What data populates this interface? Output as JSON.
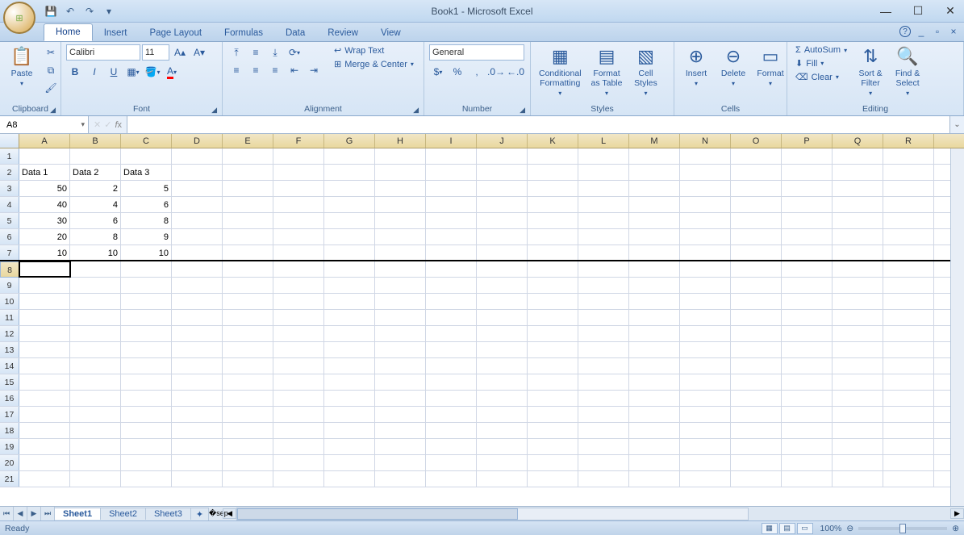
{
  "title": "Book1 - Microsoft Excel",
  "qat": {
    "save": "💾",
    "undo": "↶",
    "redo": "↷"
  },
  "tabs": [
    "Home",
    "Insert",
    "Page Layout",
    "Formulas",
    "Data",
    "Review",
    "View"
  ],
  "active_tab": "Home",
  "ribbon": {
    "clipboard": {
      "label": "Clipboard",
      "paste": "Paste"
    },
    "font": {
      "label": "Font",
      "name": "Calibri",
      "size": "11"
    },
    "alignment": {
      "label": "Alignment",
      "wrap": "Wrap Text",
      "merge": "Merge & Center"
    },
    "number": {
      "label": "Number",
      "format": "General"
    },
    "styles": {
      "label": "Styles",
      "cond": "Conditional\nFormatting",
      "fmt": "Format\nas Table",
      "cell": "Cell\nStyles"
    },
    "cells": {
      "label": "Cells",
      "ins": "Insert",
      "del": "Delete",
      "fmt": "Format"
    },
    "editing": {
      "label": "Editing",
      "autosum": "AutoSum",
      "fill": "Fill",
      "clear": "Clear",
      "sort": "Sort &\nFilter",
      "find": "Find &\nSelect"
    }
  },
  "namebox": "A8",
  "formula": "",
  "columns": [
    "A",
    "B",
    "C",
    "D",
    "E",
    "F",
    "G",
    "H",
    "I",
    "J",
    "K",
    "L",
    "M",
    "N",
    "O",
    "P",
    "Q",
    "R"
  ],
  "row_count": 21,
  "active_cell": {
    "row": 8,
    "col": 0
  },
  "data": {
    "2": {
      "A": "Data 1",
      "B": "Data 2",
      "C": "Data 3"
    },
    "3": {
      "A": "50",
      "B": "2",
      "C": "5"
    },
    "4": {
      "A": "40",
      "B": "4",
      "C": "6"
    },
    "5": {
      "A": "30",
      "B": "6",
      "C": "8"
    },
    "6": {
      "A": "20",
      "B": "8",
      "C": "9"
    },
    "7": {
      "A": "10",
      "B": "10",
      "C": "10"
    }
  },
  "sheets": [
    "Sheet1",
    "Sheet2",
    "Sheet3"
  ],
  "active_sheet": "Sheet1",
  "status": {
    "ready": "Ready",
    "zoom": "100%"
  },
  "chart_data": {
    "type": "table",
    "headers": [
      "Data 1",
      "Data 2",
      "Data 3"
    ],
    "rows": [
      [
        50,
        2,
        5
      ],
      [
        40,
        4,
        6
      ],
      [
        30,
        6,
        8
      ],
      [
        20,
        8,
        9
      ],
      [
        10,
        10,
        10
      ]
    ]
  }
}
